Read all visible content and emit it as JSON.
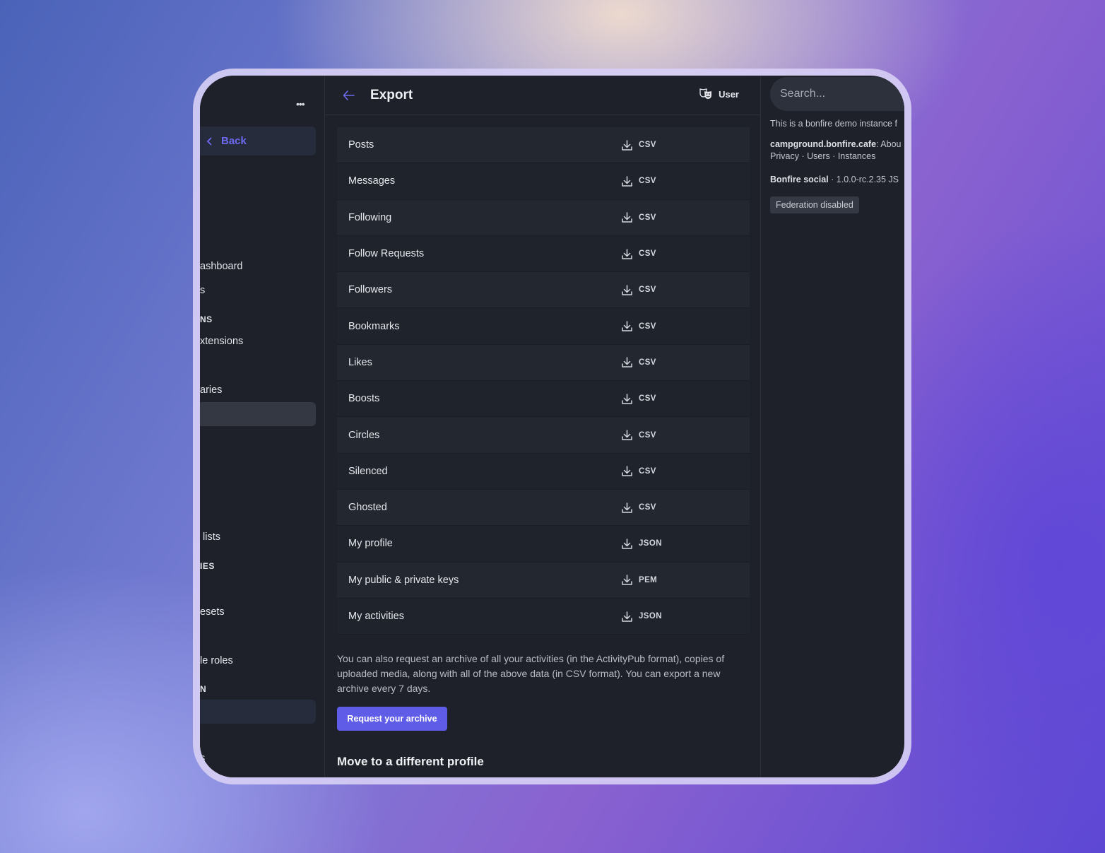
{
  "sidebar": {
    "back_label": "Back",
    "items": [
      {
        "label": "ashboard"
      },
      {
        "label": "s"
      },
      {
        "label": "xtensions"
      },
      {
        "label": "aries"
      },
      {
        "label": "lists"
      },
      {
        "label": "esets"
      },
      {
        "label": "le roles"
      },
      {
        "label": "s"
      }
    ],
    "headings": [
      "NS",
      "IES",
      "N"
    ]
  },
  "header": {
    "title": "Export",
    "user_label": "User"
  },
  "export_rows": [
    {
      "label": "Posts",
      "format": "CSV"
    },
    {
      "label": "Messages",
      "format": "CSV"
    },
    {
      "label": "Following",
      "format": "CSV"
    },
    {
      "label": "Follow Requests",
      "format": "CSV"
    },
    {
      "label": "Followers",
      "format": "CSV"
    },
    {
      "label": "Bookmarks",
      "format": "CSV"
    },
    {
      "label": "Likes",
      "format": "CSV"
    },
    {
      "label": "Boosts",
      "format": "CSV"
    },
    {
      "label": "Circles",
      "format": "CSV"
    },
    {
      "label": "Silenced",
      "format": "CSV"
    },
    {
      "label": "Ghosted",
      "format": "CSV"
    },
    {
      "label": "My profile",
      "format": "JSON"
    },
    {
      "label": "My public & private keys",
      "format": "PEM"
    },
    {
      "label": "My activities",
      "format": "JSON"
    }
  ],
  "archive": {
    "note": "You can also request an archive of all your activities (in the ActivityPub format), copies of uploaded media, along with all of the above data (in CSV format). You can export a new archive every 7 days.",
    "button_label": "Request your archive"
  },
  "move_section": {
    "title": "Move to a different profile"
  },
  "right_panel": {
    "search_placeholder": "Search...",
    "demo_text": "This is a bonfire demo instance f",
    "instance_name": "campground.bonfire.cafe",
    "instance_links": ": Abou",
    "links_line": "Privacy · Users · Instances",
    "app_name": "Bonfire social",
    "version": " · 1.0.0-rc.2.35  JS",
    "federation_badge": "Federation disabled"
  },
  "colors": {
    "accent": "#5f5ce8",
    "link": "#6d6af0",
    "panel_bg": "#1e2129"
  }
}
